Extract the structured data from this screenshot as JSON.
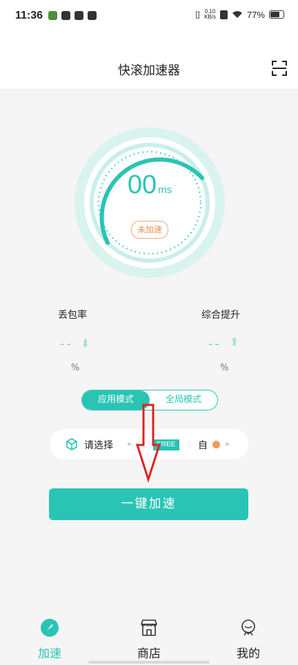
{
  "status_bar": {
    "time": "11:36",
    "net_speed_value": "0.10",
    "net_speed_unit": "KB/s",
    "battery": "77%"
  },
  "header": {
    "title": "快滚加速器",
    "scan_icon": "scan-icon"
  },
  "gauge": {
    "ping_value": "00",
    "ping_unit": "ms",
    "status": "未加速",
    "accent_color": "#2ac4b4"
  },
  "metrics": {
    "packet_loss": {
      "label": "丢包率",
      "value": "--",
      "unit": "%"
    },
    "improvement": {
      "label": "综合提升",
      "value": "--",
      "unit": "%"
    }
  },
  "mode": {
    "app_mode": "应用模式",
    "global_mode": "全局模式",
    "selected": "应用模式"
  },
  "selector": {
    "placeholder": "请选择",
    "chevron": "»",
    "badge": "FREE",
    "auto": "自"
  },
  "accelerate_button": "一键加速",
  "tabs": [
    {
      "label": "加速",
      "icon": "rocket-icon",
      "active": true
    },
    {
      "label": "商店",
      "icon": "store-icon",
      "active": false
    },
    {
      "label": "我的",
      "icon": "profile-icon",
      "active": false
    }
  ]
}
